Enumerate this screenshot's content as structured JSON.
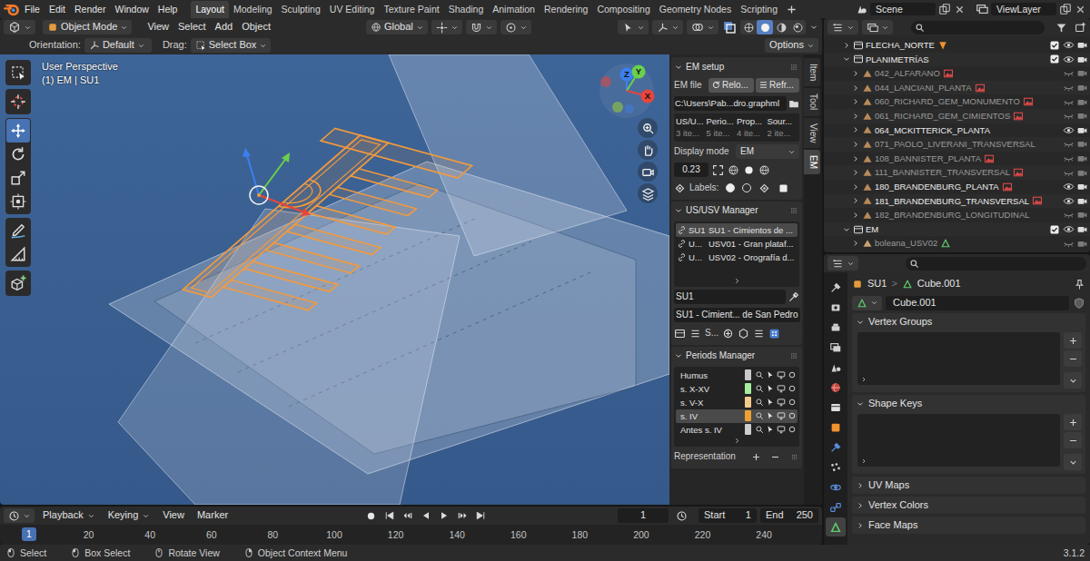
{
  "topbar": {
    "menus": [
      "File",
      "Edit",
      "Render",
      "Window",
      "Help"
    ],
    "workspaces": [
      {
        "label": "Layout",
        "selected": true
      },
      {
        "label": "Modeling",
        "selected": false
      },
      {
        "label": "Sculpting",
        "selected": false
      },
      {
        "label": "UV Editing",
        "selected": false
      },
      {
        "label": "Texture Paint",
        "selected": false
      },
      {
        "label": "Shading",
        "selected": false
      },
      {
        "label": "Animation",
        "selected": false
      },
      {
        "label": "Rendering",
        "selected": false
      },
      {
        "label": "Compositing",
        "selected": false
      },
      {
        "label": "Geometry Nodes",
        "selected": false
      },
      {
        "label": "Scripting",
        "selected": false
      }
    ],
    "scene": "Scene",
    "view_layer": "ViewLayer"
  },
  "viewport": {
    "mode": "Object Mode",
    "menus": [
      "View",
      "Select",
      "Add",
      "Object"
    ],
    "transform_space": "Global",
    "shading": [
      {
        "selected": false
      },
      {
        "selected": true
      },
      {
        "selected": false
      },
      {
        "selected": false
      }
    ],
    "orientation_label": "Orientation:",
    "orientation": "Default",
    "drag_label": "Drag:",
    "drag": "Select Box",
    "options": "Options",
    "view_name": "User Perspective",
    "context": "(1) EM | SU1",
    "tools": [
      {
        "selected": false
      },
      {
        "selected": false
      },
      {
        "selected": true
      },
      {
        "selected": false
      },
      {
        "selected": false
      },
      {
        "selected": false
      },
      {
        "selected": false
      },
      {
        "selected": false
      },
      {
        "selected": false
      }
    ],
    "gizmo": {
      "x": "X",
      "y": "Y",
      "z": "Z"
    }
  },
  "sidebar": {
    "tabs": [
      {
        "label": "Item",
        "selected": false
      },
      {
        "label": "Tool",
        "selected": false
      },
      {
        "label": "View",
        "selected": false
      },
      {
        "label": "EM",
        "selected": true
      }
    ],
    "em_setup": {
      "title": "EM setup",
      "file_label": "EM file",
      "reload": "Relo...",
      "refresh": "Refr...",
      "path": "C:\\Users\\Pab...dro.graphml",
      "columns": [
        {
          "label": "US/U...",
          "count": "3 ite..."
        },
        {
          "label": "Perio...",
          "count": "5 ite..."
        },
        {
          "label": "Prop...",
          "count": "4 ite..."
        },
        {
          "label": "Sour...",
          "count": "2 ite..."
        }
      ],
      "display_mode_label": "Display mode",
      "display_mode": "EM",
      "alpha": "0.23",
      "labels_label": "Labels:",
      "label_options": [
        {
          "selected": true
        },
        {
          "selected": false
        }
      ]
    },
    "us_manager": {
      "title": "US/USV Manager",
      "items": [
        {
          "code": "SU1",
          "description": "SU1 - Cimientos de ...",
          "selected": true
        },
        {
          "code": "U...",
          "description": "USV01 - Gran plataf...",
          "selected": false
        },
        {
          "code": "U...",
          "description": "USV02 - Orografía d...",
          "selected": false
        }
      ],
      "name": "SU1",
      "description": "SU1 - Cimient... de San Pedro",
      "tool_label": "S..."
    },
    "periods": {
      "title": "Periods Manager",
      "items": [
        {
          "name": "Humus",
          "color": "#c8c8c8",
          "selected": false
        },
        {
          "name": "s. X-XV",
          "color": "#a6ee9c",
          "selected": false
        },
        {
          "name": "s. V-X",
          "color": "#f4c98c",
          "selected": false
        },
        {
          "name": "s. IV",
          "color": "#f0a032",
          "selected": true
        },
        {
          "name": "Antes s. IV",
          "color": "#cdcdcd",
          "selected": false
        }
      ],
      "representation": "Representation"
    }
  },
  "timeline": {
    "menus": [
      {
        "label": "Playback",
        "dropdown": true
      },
      {
        "label": "Keying",
        "dropdown": true
      },
      {
        "label": "View",
        "dropdown": false
      },
      {
        "label": "Marker",
        "dropdown": false
      }
    ],
    "current_frame": "1",
    "start_label": "Start",
    "start": "1",
    "end_label": "End",
    "end": "250",
    "ticks": [
      "20",
      "40",
      "60",
      "80",
      "100",
      "120",
      "140",
      "160",
      "180",
      "200",
      "220",
      "240"
    ],
    "playhead": "1"
  },
  "outliner": {
    "items": [
      {
        "label": "FLECHA_NORTE",
        "depth": 0,
        "kind": "collection",
        "expanded": false,
        "visible": true,
        "checked": true,
        "badge": true
      },
      {
        "label": "PLANIMETRÍAS",
        "depth": 0,
        "kind": "collection",
        "expanded": true,
        "visible": true,
        "checked": true,
        "badge": false
      },
      {
        "label": "042_ALFARANO",
        "depth": 1,
        "kind": "image",
        "expanded": false,
        "visible": false,
        "badge": true
      },
      {
        "label": "044_LANCIANI_PLANTA",
        "depth": 1,
        "kind": "image",
        "expanded": false,
        "visible": false,
        "badge": true
      },
      {
        "label": "060_RICHARD_GEM_MONUMENTO",
        "depth": 1,
        "kind": "image",
        "expanded": false,
        "visible": false,
        "badge": true
      },
      {
        "label": "061_RICHARD_GEM_CIMIENTOS",
        "depth": 1,
        "kind": "image",
        "expanded": false,
        "visible": false,
        "badge": true
      },
      {
        "label": "064_MCKITTERICK_PLANTA",
        "depth": 1,
        "kind": "image",
        "expanded": false,
        "visible": true,
        "badge": false
      },
      {
        "label": "071_PAOLO_LIVERANI_TRANSVERSAL",
        "depth": 1,
        "kind": "image",
        "expanded": false,
        "visible": false,
        "badge": false
      },
      {
        "label": "108_BANNISTER_PLANTA",
        "depth": 1,
        "kind": "image",
        "expanded": false,
        "visible": false,
        "badge": true
      },
      {
        "label": "111_BANNISTER_TRANSVERSAL",
        "depth": 1,
        "kind": "image",
        "expanded": false,
        "visible": false,
        "badge": true
      },
      {
        "label": "180_BRANDENBURG_PLANTA",
        "depth": 1,
        "kind": "image",
        "expanded": false,
        "visible": true,
        "badge": true
      },
      {
        "label": "181_BRANDENBURG_TRANSVERSAL",
        "depth": 1,
        "kind": "image",
        "expanded": false,
        "visible": true,
        "badge": true
      },
      {
        "label": "182_BRANDENBURG_LONGITUDINAL",
        "depth": 1,
        "kind": "image",
        "expanded": false,
        "visible": false,
        "badge": false
      },
      {
        "label": "EM",
        "depth": 0,
        "kind": "collection",
        "expanded": true,
        "visible": true,
        "checked": true,
        "badge": false
      },
      {
        "label": "boleana_USV02",
        "depth": 1,
        "kind": "mesh",
        "expanded": false,
        "visible": false,
        "badge": true
      }
    ]
  },
  "properties": {
    "tabs": [
      {
        "selected": false
      },
      {
        "selected": false
      },
      {
        "selected": false
      },
      {
        "selected": false
      },
      {
        "selected": false
      },
      {
        "selected": false
      },
      {
        "selected": false
      },
      {
        "selected": false
      },
      {
        "selected": false
      },
      {
        "selected": false
      },
      {
        "selected": false
      },
      {
        "selected": false
      },
      {
        "selected": true
      }
    ],
    "object": "SU1",
    "separator": ">",
    "data": "Cube.001",
    "data_name": "Cube.001",
    "panels": [
      {
        "title": "Vertex Groups",
        "expanded": true
      },
      {
        "title": "Shape Keys",
        "expanded": true
      },
      {
        "title": "UV Maps",
        "expanded": false
      },
      {
        "title": "Vertex Colors",
        "expanded": false
      },
      {
        "title": "Face Maps",
        "expanded": false
      }
    ]
  },
  "status_bar": {
    "items": [
      "Select",
      "Box Select",
      "Rotate View",
      "Object Context Menu"
    ],
    "version": "3.1.2"
  }
}
